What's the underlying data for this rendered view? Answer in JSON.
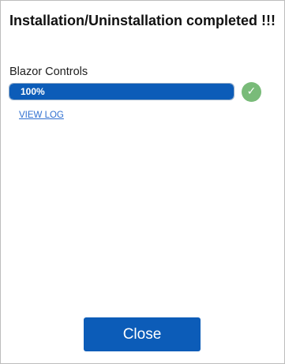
{
  "dialog": {
    "title": "Installation/Uninstallation completed !!!"
  },
  "item": {
    "name": "Blazor Controls",
    "progress_label": "100%",
    "progress_fraction": 1.0,
    "status_icon": "check-icon",
    "status_glyph": "✓",
    "view_log_label": "VIEW LOG"
  },
  "footer": {
    "close_label": "Close"
  },
  "colors": {
    "accent": "#0c5cb8",
    "success": "#79bb79",
    "link": "#2f6fd0"
  }
}
